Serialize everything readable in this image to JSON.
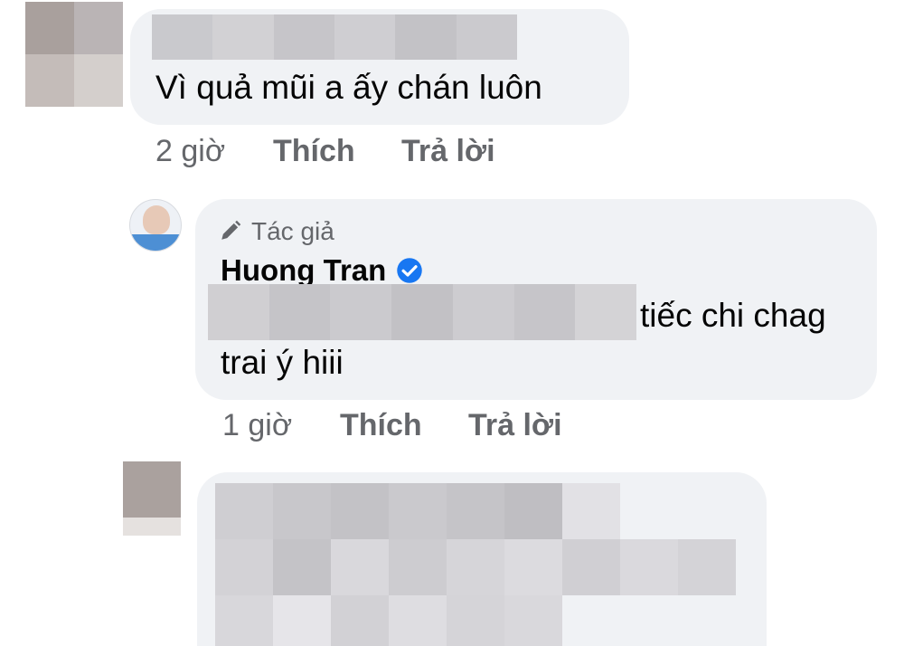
{
  "comment1": {
    "text": "Vì quả mũi a ấy chán luôn",
    "actions": {
      "time": "2 giờ",
      "like": "Thích",
      "reply": "Trả lời"
    }
  },
  "reply": {
    "badge_label": "Tác giả",
    "badge_icon": "pencil-icon",
    "author_name": "Huong Tran",
    "verified_icon": "verified-check-icon",
    "text_line1_visible": "tiếc chi chag",
    "text_line2": "trai ý hiii",
    "actions": {
      "time": "1 giờ",
      "like": "Thích",
      "reply": "Trả lời"
    }
  },
  "colors": {
    "bubble": "#f0f2f5",
    "meta_text": "#65676b",
    "verified": "#1877f2"
  }
}
